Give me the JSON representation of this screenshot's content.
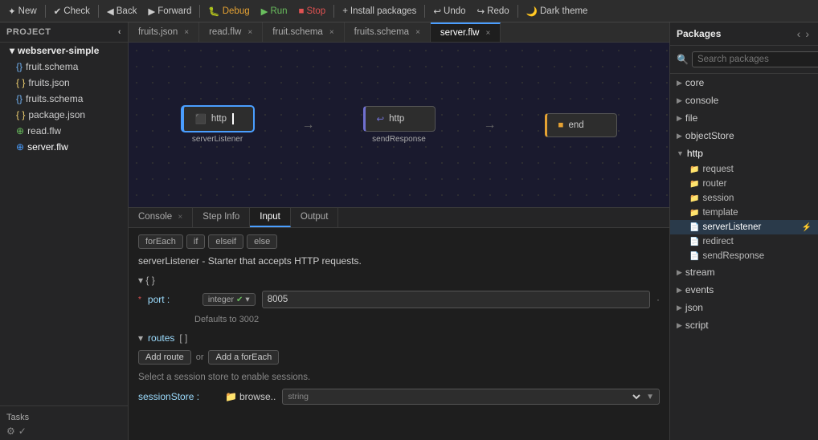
{
  "toolbar": {
    "new_label": "New",
    "check_label": "Check",
    "back_label": "Back",
    "forward_label": "Forward",
    "debug_label": "Debug",
    "run_label": "Run",
    "stop_label": "Stop",
    "install_label": "Install packages",
    "undo_label": "Undo",
    "redo_label": "Redo",
    "dark_theme_label": "Dark theme"
  },
  "project": {
    "header": "Project",
    "root_folder": "webserver-simple",
    "files": [
      {
        "name": "fruit.schema",
        "type": "schema"
      },
      {
        "name": "fruits.json",
        "type": "json"
      },
      {
        "name": "fruits.schema",
        "type": "schema"
      },
      {
        "name": "package.json",
        "type": "json"
      },
      {
        "name": "read.flw",
        "type": "flw-green"
      },
      {
        "name": "server.flw",
        "type": "flw-blue"
      }
    ]
  },
  "tabs": [
    {
      "label": "fruits.json",
      "closable": true
    },
    {
      "label": "read.flw",
      "closable": true
    },
    {
      "label": "fruit.schema",
      "closable": true
    },
    {
      "label": "fruits.schema",
      "closable": true
    },
    {
      "label": "server.flw",
      "closable": true,
      "active": true
    }
  ],
  "canvas": {
    "nodes": [
      {
        "id": "serverListener",
        "icon": "⚡",
        "label": "http",
        "sublabel": "serverListener",
        "type": "http",
        "selected": true
      },
      {
        "id": "sendResponse",
        "icon": "↩",
        "label": "http",
        "sublabel": "sendResponse",
        "type": "http",
        "selected": false
      },
      {
        "id": "end",
        "icon": "■",
        "label": "end",
        "sublabel": "",
        "type": "end",
        "selected": false
      }
    ]
  },
  "panel_tabs": [
    {
      "label": "Console",
      "closable": true,
      "active": false
    },
    {
      "label": "Step Info",
      "closable": false,
      "active": false
    },
    {
      "label": "Input",
      "closable": false,
      "active": true
    },
    {
      "label": "Output",
      "closable": false,
      "active": false
    }
  ],
  "filter_buttons": [
    "forEach",
    "if",
    "elseif",
    "else"
  ],
  "input_panel": {
    "description": "serverListener - Starter that accepts HTTP requests.",
    "port_label": "port :",
    "port_type": "integer",
    "port_value": "8005",
    "port_dot": "·",
    "defaults_text": "Defaults to 3002",
    "routes_label": "routes",
    "routes_bracket": "[ ]",
    "add_route_label": "Add route",
    "or_label": "or",
    "add_foreach_label": "Add a forEach",
    "session_hint": "Select a session store to enable sessions.",
    "session_store_label": "sessionStore :",
    "session_browse_icon": "📁",
    "session_browse_text": "browse..",
    "session_string_label": "string",
    "session_dropdown_value": "",
    "session_chevron": "▼"
  },
  "packages": {
    "title": "Packages",
    "search_placeholder": "Search packages",
    "categories": [
      {
        "name": "core",
        "expanded": false
      },
      {
        "name": "console",
        "expanded": false
      },
      {
        "name": "file",
        "expanded": false
      },
      {
        "name": "objectStore",
        "expanded": false
      },
      {
        "name": "http",
        "expanded": true,
        "items": [
          {
            "name": "request",
            "type": "folder"
          },
          {
            "name": "router",
            "type": "folder"
          },
          {
            "name": "session",
            "type": "folder"
          },
          {
            "name": "template",
            "type": "folder"
          },
          {
            "name": "serverListener",
            "type": "file",
            "active": true,
            "lightning": true
          },
          {
            "name": "redirect",
            "type": "file",
            "active": false
          },
          {
            "name": "sendResponse",
            "type": "file",
            "active": false
          }
        ]
      },
      {
        "name": "stream",
        "expanded": false
      },
      {
        "name": "events",
        "expanded": false
      },
      {
        "name": "json",
        "expanded": false
      },
      {
        "name": "script",
        "expanded": false
      }
    ]
  },
  "tasks": {
    "label": "Tasks",
    "gear_icon": "⚙",
    "check_icon": "✓"
  }
}
